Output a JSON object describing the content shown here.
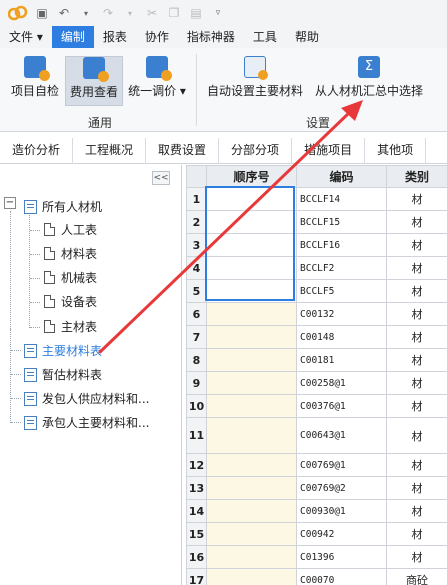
{
  "menubar": [
    "文件",
    "编制",
    "报表",
    "协作",
    "指标神器",
    "工具",
    "帮助"
  ],
  "menubar_active": 1,
  "ribbon": {
    "buttons": {
      "self_check": "项目自检",
      "fee_view": "费用查看",
      "unified_price": "统一调价",
      "auto_set": "自动设置主要材料",
      "select_from": "从人材机汇总中选择"
    },
    "groups": {
      "general": "通用",
      "settings": "设置"
    }
  },
  "tabs": [
    "造价分析",
    "工程概况",
    "取费设置",
    "分部分项",
    "措施项目",
    "其他项"
  ],
  "tree": {
    "root": "所有人材机",
    "children": [
      "人工表",
      "材料表",
      "机械表",
      "设备表",
      "主材表"
    ],
    "others": [
      "主要材料表",
      "暂估材料表",
      "发包人供应材料和...",
      "承包人主要材料和..."
    ],
    "highlight": "主要材料表"
  },
  "grid": {
    "headers": [
      "顺序号",
      "编码",
      "类别"
    ],
    "rows": [
      {
        "n": "1",
        "code": "BCCLF14",
        "cat": "材"
      },
      {
        "n": "2",
        "code": "BCCLF15",
        "cat": "材"
      },
      {
        "n": "3",
        "code": "BCCLF16",
        "cat": "材"
      },
      {
        "n": "4",
        "code": "BCCLF2",
        "cat": "材"
      },
      {
        "n": "5",
        "code": "BCCLF5",
        "cat": "材"
      },
      {
        "n": "6",
        "code": "C00132",
        "cat": "材"
      },
      {
        "n": "7",
        "code": "C00148",
        "cat": "材"
      },
      {
        "n": "8",
        "code": "C00181",
        "cat": "材"
      },
      {
        "n": "9",
        "code": "C00258@1",
        "cat": "材"
      },
      {
        "n": "10",
        "code": "C00376@1",
        "cat": "材"
      },
      {
        "n": "11",
        "code": "C00643@1",
        "cat": "材"
      },
      {
        "n": "12",
        "code": "C00769@1",
        "cat": "材"
      },
      {
        "n": "13",
        "code": "C00769@2",
        "cat": "材"
      },
      {
        "n": "14",
        "code": "C00930@1",
        "cat": "材"
      },
      {
        "n": "15",
        "code": "C00942",
        "cat": "材"
      },
      {
        "n": "16",
        "code": "C01396",
        "cat": "材"
      },
      {
        "n": "17",
        "code": "C00070",
        "cat": "商砼"
      }
    ]
  },
  "colors": {
    "accent": "#2d7ee0",
    "arrow": "#e8383a",
    "seq_yellow": "#fdf8e4"
  }
}
